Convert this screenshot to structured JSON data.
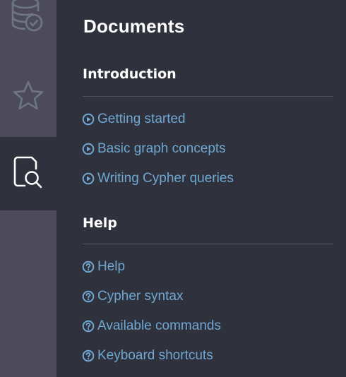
{
  "colors": {
    "rail_background": "#4d4b5b",
    "drawer_background": "#2f313c",
    "link": "#6fa8d2",
    "heading": "#ffffff",
    "icon_outline": "#6d7682",
    "active_icon": "#ffffff"
  },
  "rail": {
    "items": [
      {
        "icon": "database-check-icon",
        "active": false
      },
      {
        "icon": "star-icon",
        "active": false
      },
      {
        "icon": "document-search-icon",
        "active": true
      }
    ]
  },
  "drawer": {
    "title": "Documents",
    "sections": [
      {
        "title": "Introduction",
        "link_icon": "play-circle-icon",
        "items": [
          "Getting started",
          "Basic graph concepts",
          "Writing Cypher queries"
        ]
      },
      {
        "title": "Help",
        "link_icon": "question-circle-icon",
        "items": [
          "Help",
          "Cypher syntax",
          "Available commands",
          "Keyboard shortcuts"
        ]
      }
    ]
  }
}
